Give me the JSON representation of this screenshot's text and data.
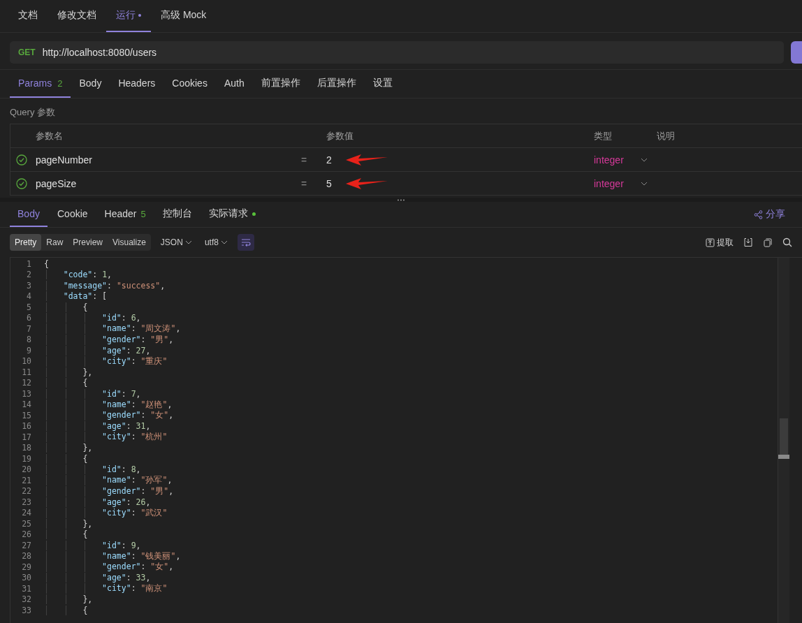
{
  "doc_tabs": [
    {
      "label": "文档",
      "selected": false,
      "modified": false
    },
    {
      "label": "修改文档",
      "selected": false,
      "modified": false
    },
    {
      "label": "运行",
      "selected": true,
      "modified": true
    },
    {
      "label": "高级 Mock",
      "selected": false,
      "modified": false
    }
  ],
  "request": {
    "method": "GET",
    "url": "http://localhost:8080/users"
  },
  "request_tabs": [
    {
      "label": "Params",
      "count": "2",
      "selected": true
    },
    {
      "label": "Body",
      "selected": false
    },
    {
      "label": "Headers",
      "selected": false
    },
    {
      "label": "Cookies",
      "selected": false
    },
    {
      "label": "Auth",
      "selected": false
    },
    {
      "label": "前置操作",
      "selected": false
    },
    {
      "label": "后置操作",
      "selected": false
    },
    {
      "label": "设置",
      "selected": false
    }
  ],
  "query": {
    "title": "Query 参数",
    "columns": [
      "参数名",
      "参数值",
      "类型",
      "说明"
    ],
    "rows": [
      {
        "enabled": true,
        "name": "pageNumber",
        "operator": "=",
        "value": "2",
        "type": "integer",
        "annotated": true
      },
      {
        "enabled": true,
        "name": "pageSize",
        "operator": "=",
        "value": "5",
        "type": "integer",
        "annotated": true
      }
    ]
  },
  "response_tabs": [
    {
      "label": "Body",
      "selected": true,
      "dot": false
    },
    {
      "label": "Cookie",
      "selected": false,
      "dot": false
    },
    {
      "label": "Header",
      "count": "5",
      "selected": false,
      "dot": false
    },
    {
      "label": "控制台",
      "selected": false,
      "dot": false
    },
    {
      "label": "实际请求",
      "selected": false,
      "dot": true
    }
  ],
  "share": "分享",
  "view_modes": [
    {
      "label": "Pretty",
      "selected": true
    },
    {
      "label": "Raw",
      "selected": false
    },
    {
      "label": "Preview",
      "selected": false
    },
    {
      "label": "Visualize",
      "selected": false
    }
  ],
  "format": "JSON",
  "encoding": "utf8",
  "extract": "提取",
  "code_lines": [
    {
      "num": "1",
      "text": "{"
    },
    {
      "num": "2",
      "text": "    \"code\": 1,"
    },
    {
      "num": "3",
      "text": "    \"message\": \"success\","
    },
    {
      "num": "4",
      "text": "    \"data\": ["
    },
    {
      "num": "5",
      "text": "        {"
    },
    {
      "num": "6",
      "text": "            \"id\": 6,"
    },
    {
      "num": "7",
      "text": "            \"name\": \"周文涛\","
    },
    {
      "num": "8",
      "text": "            \"gender\": \"男\","
    },
    {
      "num": "9",
      "text": "            \"age\": 27,"
    },
    {
      "num": "10",
      "text": "            \"city\": \"重庆\""
    },
    {
      "num": "11",
      "text": "        },"
    },
    {
      "num": "12",
      "text": "        {"
    },
    {
      "num": "13",
      "text": "            \"id\": 7,"
    },
    {
      "num": "14",
      "text": "            \"name\": \"赵艳\","
    },
    {
      "num": "15",
      "text": "            \"gender\": \"女\","
    },
    {
      "num": "16",
      "text": "            \"age\": 31,"
    },
    {
      "num": "17",
      "text": "            \"city\": \"杭州\""
    },
    {
      "num": "18",
      "text": "        },"
    },
    {
      "num": "19",
      "text": "        {"
    },
    {
      "num": "20",
      "text": "            \"id\": 8,"
    },
    {
      "num": "21",
      "text": "            \"name\": \"孙军\","
    },
    {
      "num": "22",
      "text": "            \"gender\": \"男\","
    },
    {
      "num": "23",
      "text": "            \"age\": 26,"
    },
    {
      "num": "24",
      "text": "            \"city\": \"武汉\""
    },
    {
      "num": "25",
      "text": "        },"
    },
    {
      "num": "26",
      "text": "        {"
    },
    {
      "num": "27",
      "text": "            \"id\": 9,"
    },
    {
      "num": "28",
      "text": "            \"name\": \"钱美丽\","
    },
    {
      "num": "29",
      "text": "            \"gender\": \"女\","
    },
    {
      "num": "30",
      "text": "            \"age\": 33,"
    },
    {
      "num": "31",
      "text": "            \"city\": \"南京\""
    },
    {
      "num": "32",
      "text": "        },"
    },
    {
      "num": "33",
      "text": "        {"
    }
  ]
}
